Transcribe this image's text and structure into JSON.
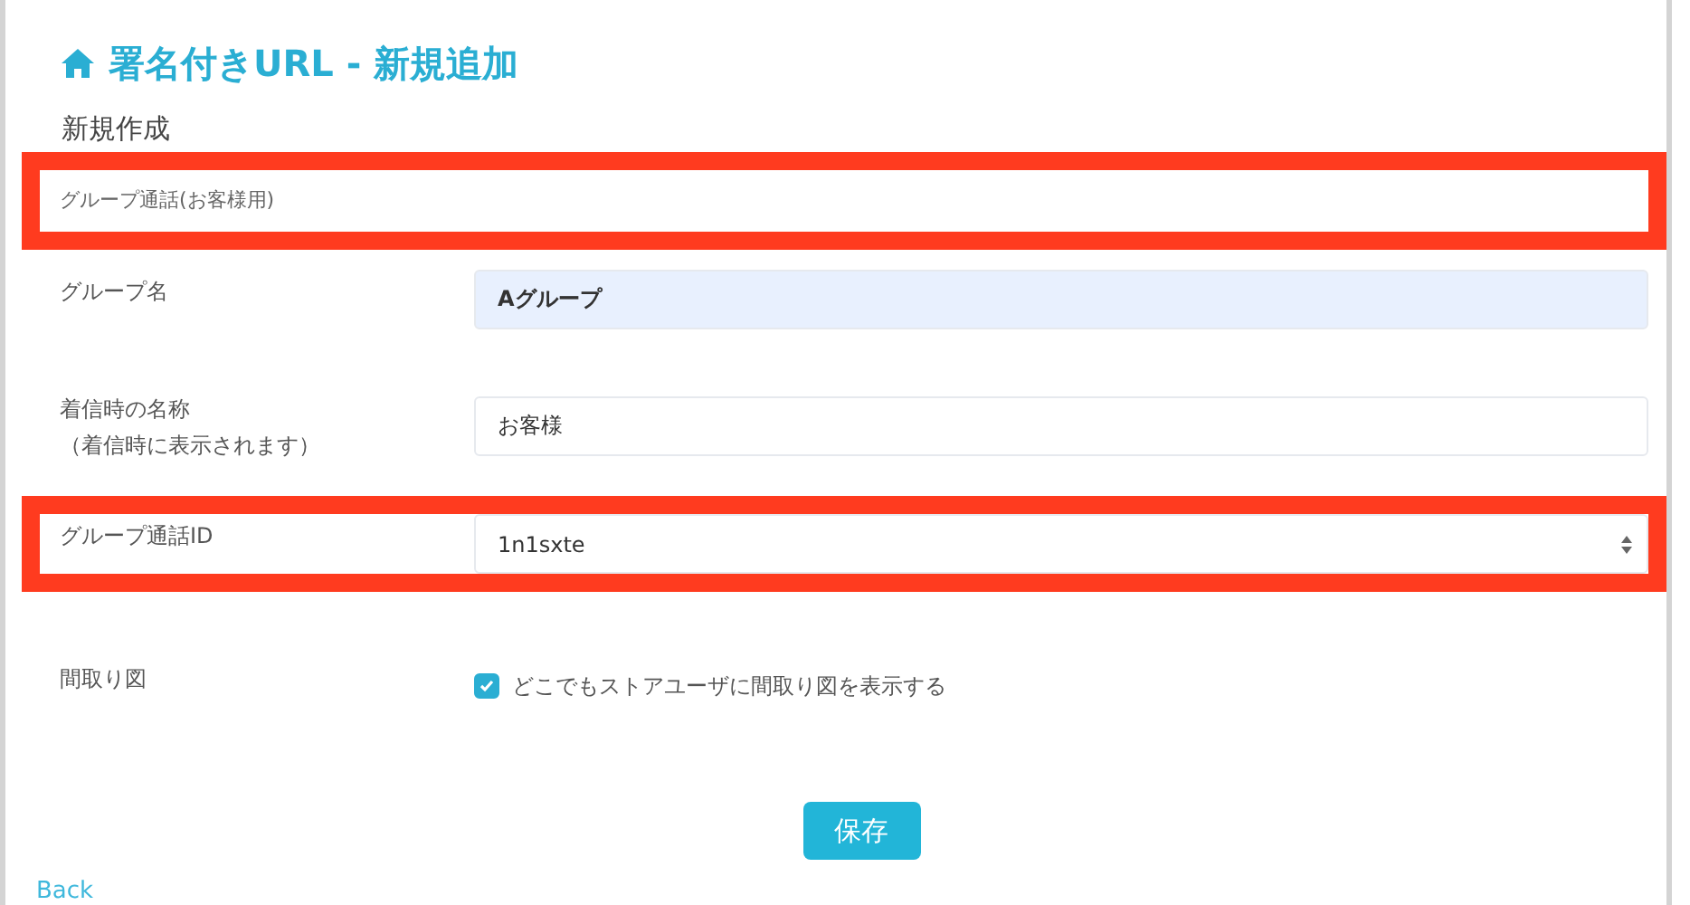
{
  "page": {
    "title": "署名付きURL - 新規追加",
    "subtitle": "新規作成"
  },
  "section_header": {
    "text": "グループ通話(お客様用)",
    "highlighted": true
  },
  "fields": [
    {
      "kind": "text",
      "label": "グループ名",
      "value": "Aグループ",
      "autofilled": true,
      "highlighted": false
    },
    {
      "kind": "text",
      "label": "着信時の名称",
      "sublabel": "（着信時に表示されます）",
      "value": "お客様",
      "autofilled": false,
      "highlighted": false
    },
    {
      "kind": "select",
      "label": "グループ通話ID",
      "value": "1n1sxte",
      "highlighted": true
    },
    {
      "kind": "checkbox",
      "label": "間取り図",
      "option": "どこでもストアユーザに間取り図を表示する",
      "checked": true,
      "highlighted": false
    }
  ],
  "save_button": "保存",
  "back_link": "Back"
}
